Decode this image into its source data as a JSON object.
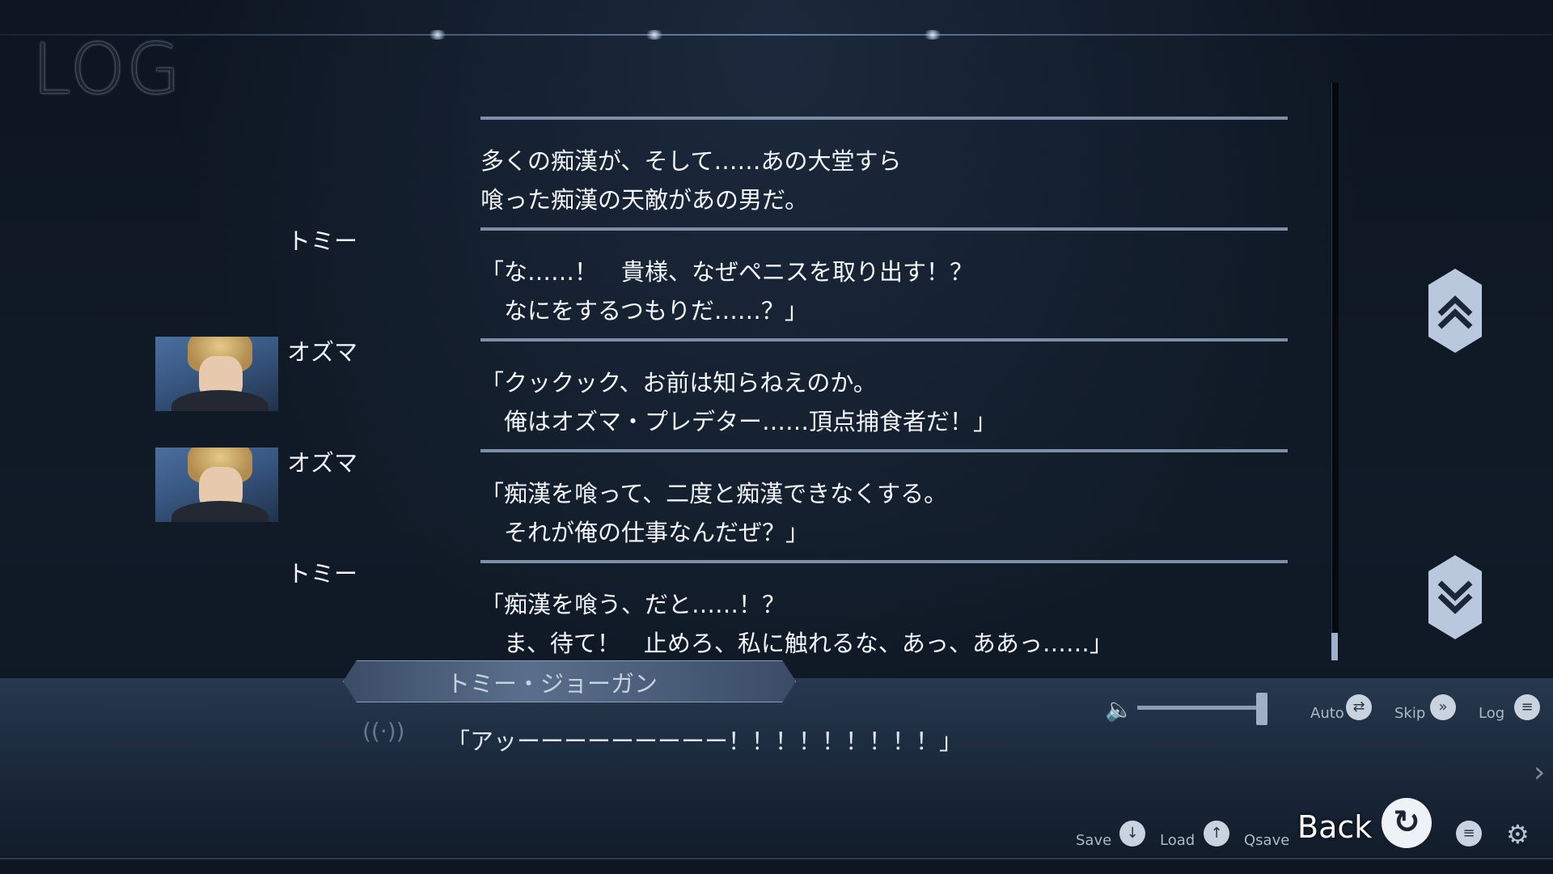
{
  "title": "LOG",
  "entries": [
    {
      "speaker": "",
      "has_avatar": false,
      "line1": "多くの痴漢が、そして……あの大堂すら",
      "line2": "喰った痴漢の天敵があの男だ。"
    },
    {
      "speaker": "トミー",
      "has_avatar": false,
      "line1": "「な……！　貴様、なぜペニスを取り出す！？",
      "line2": "　なにをするつもりだ……？」"
    },
    {
      "speaker": "オズマ",
      "has_avatar": true,
      "line1": "「クックック、お前は知らねえのか。",
      "line2": "　俺はオズマ・プレデター……頂点捕食者だ！」"
    },
    {
      "speaker": "オズマ",
      "has_avatar": true,
      "line1": "「痴漢を喰って、二度と痴漢できなくする。",
      "line2": "　それが俺の仕事なんだぜ？」"
    },
    {
      "speaker": "トミー",
      "has_avatar": false,
      "line1": "「痴漢を喰う、だと……！？",
      "line2": "　ま、待て！　止めろ、私に触れるな、あっ、ああっ……」"
    }
  ],
  "dialog": {
    "speaker": "トミー・ジョーガン",
    "text": "「アッーーーーーーーーー！！！！！！！！！」"
  },
  "controls": {
    "auto": "Auto",
    "skip": "Skip",
    "log": "Log",
    "save": "Save",
    "load": "Load",
    "qsave": "Qsave",
    "back": "Back"
  },
  "volume_level": 0.95,
  "colors": {
    "rule": "#7d8ea6",
    "background": "#0e1622"
  }
}
